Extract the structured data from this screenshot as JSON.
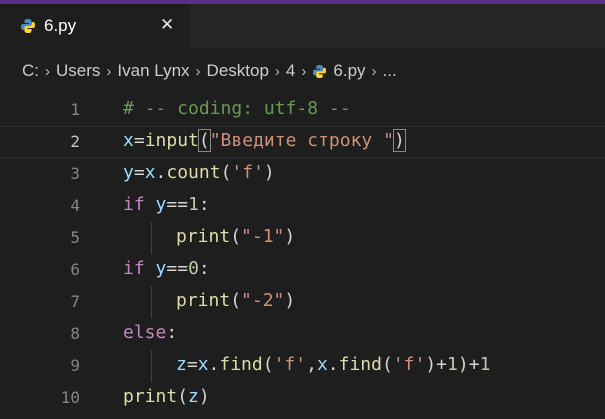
{
  "tab": {
    "label": "6.py",
    "close_glyph": "✕",
    "icon": "python-file-icon"
  },
  "breadcrumb": {
    "items": [
      "C:",
      "Users",
      "Ivan Lynx",
      "Desktop",
      "4",
      "6.py",
      "..."
    ],
    "separator": "›"
  },
  "editor": {
    "active_line": 2,
    "lines": [
      {
        "n": "1",
        "text": "# -- coding: utf-8 --"
      },
      {
        "n": "2",
        "text": "x=input(\"Введите строку \")"
      },
      {
        "n": "3",
        "text": "y=x.count('f')"
      },
      {
        "n": "4",
        "text": "if y==1:"
      },
      {
        "n": "5",
        "text": "print(\"-1\")"
      },
      {
        "n": "6",
        "text": "if y==0:"
      },
      {
        "n": "7",
        "text": "print(\"-2\")"
      },
      {
        "n": "8",
        "text": "else:"
      },
      {
        "n": "9",
        "text": "z=x.find('f',x.find('f')+1)+1"
      },
      {
        "n": "10",
        "text": "print(z)"
      }
    ]
  },
  "colors": {
    "background": "#1e1e1e",
    "accent": "#5a2d8a",
    "comment": "#6a9955",
    "keyword": "#c586c0",
    "string": "#ce9178",
    "function": "#dcdcaa",
    "variable": "#9cdcfe",
    "number": "#b5cea8"
  }
}
